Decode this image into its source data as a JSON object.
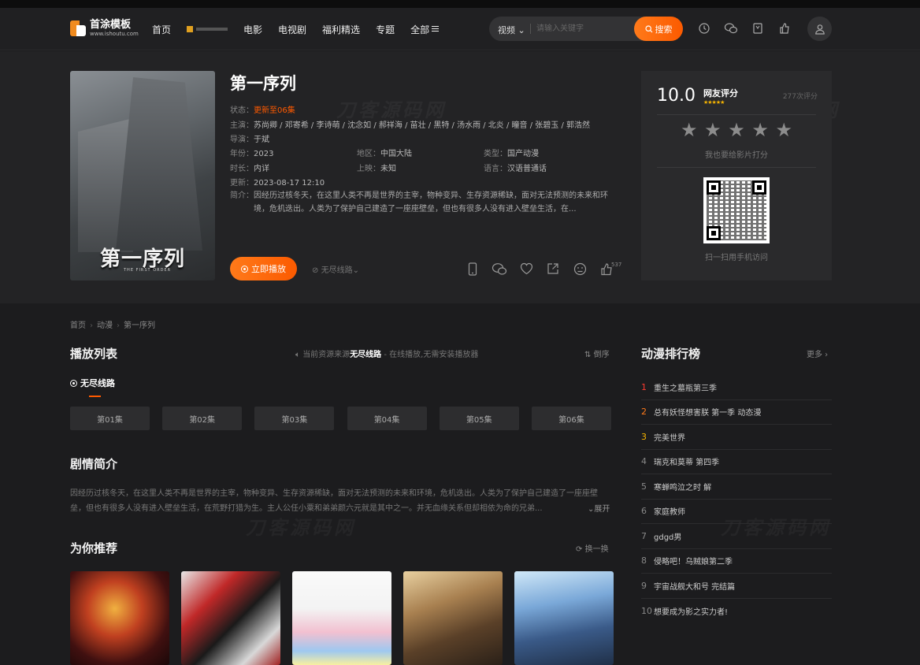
{
  "site": {
    "name": "首涂模板",
    "domain": "www.ishoutu.com"
  },
  "nav": {
    "items": [
      "首页",
      "电影",
      "电视剧",
      "福利精选",
      "专题",
      "全部"
    ]
  },
  "search": {
    "category": "视频",
    "placeholder": "请输入关键字",
    "button": "搜索"
  },
  "movie": {
    "title": "第一序列",
    "poster_title": "第一序列",
    "poster_subtitle": "THE FIRST ORDER",
    "status_label": "状态：",
    "status_value": "更新至06集",
    "cast_label": "主演：",
    "cast": "苏尚卿 / 邓寄希 / 李诗萌 / 沈念如 / 郝祥海 / 苗壮 / 黑特 / 汤水雨 / 北炎 / 瞳音 / 张碧玉 / 郭浩然",
    "director_label": "导演：",
    "director": "于斌",
    "year_label": "年份：",
    "year": "2023",
    "region_label": "地区：",
    "region": "中国大陆",
    "type_label": "类型：",
    "type": "国产动漫",
    "duration_label": "时长：",
    "duration": "内详",
    "release_label": "上映：",
    "release": "未知",
    "language_label": "语言：",
    "language": "汉语普通话",
    "updated_label": "更新：",
    "updated": "2023-08-17 12:10",
    "intro_label": "简介：",
    "intro": "因经历过核冬天，在这里人类不再是世界的主宰，物种变异、生存资源稀缺，面对无法预测的未来和环境，危机迭出。人类为了保护自己建造了一座座壁垒，但也有很多人没有进入壁垒生活，在..."
  },
  "actions": {
    "play": "立即播放",
    "line_select": "无尽线路",
    "like_count": "537"
  },
  "rating": {
    "score": "10.0",
    "label": "网友评分",
    "count": "277次评分",
    "hint": "我也要给影片打分",
    "qr_caption": "扫一扫用手机访问"
  },
  "breadcrumb": [
    "首页",
    "动漫",
    "第一序列"
  ],
  "playlist": {
    "heading": "播放列表",
    "source_prefix": "当前资源来源",
    "source_name": "无尽线路",
    "source_suffix": "- 在线播放,无需安装播放器",
    "sort": "倒序",
    "tab": "无尽线路",
    "episodes": [
      "第01集",
      "第02集",
      "第03集",
      "第04集",
      "第05集",
      "第06集"
    ]
  },
  "plot": {
    "heading": "剧情简介",
    "text": "因经历过核冬天，在这里人类不再是世界的主宰，物种变异、生存资源稀缺，面对无法预测的未来和环境，危机迭出。人类为了保护自己建造了一座座壁垒，但也有很多人没有进入壁垒生活，在荒野打猎为生。主人公任小粟和弟弟颜六元就是其中之一。并无血缘关系但却相依为命的兄弟...",
    "expand": "展开"
  },
  "recommend": {
    "heading": "为你推荐",
    "refresh": "换一换"
  },
  "ranking": {
    "heading": "动漫排行榜",
    "more": "更多",
    "items": [
      {
        "rank": "1",
        "title": "重生之墓瓶第三季"
      },
      {
        "rank": "2",
        "title": "总有妖怪想害朕 第一季 动态漫"
      },
      {
        "rank": "3",
        "title": "完美世界"
      },
      {
        "rank": "4",
        "title": "瑞克和莫蒂 第四季"
      },
      {
        "rank": "5",
        "title": "寒蝉鸣泣之时 解"
      },
      {
        "rank": "6",
        "title": "家庭教师"
      },
      {
        "rank": "7",
        "title": "gdgd男"
      },
      {
        "rank": "8",
        "title": "侵略吧！乌贼娘第二季"
      },
      {
        "rank": "9",
        "title": "宇宙战舰大和号 完结篇"
      },
      {
        "rank": "10",
        "title": "想要成为影之实力者!"
      }
    ]
  },
  "watermark": "刀客源码网"
}
